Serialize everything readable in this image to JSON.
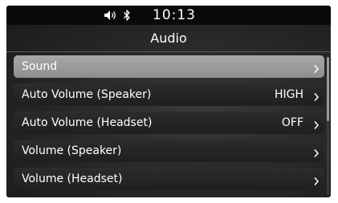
{
  "status_bar": {
    "speaker_icon": "speaker-sound-icon",
    "bluetooth_icon": "bluetooth-icon",
    "time": "10:13"
  },
  "header": {
    "title": "Audio"
  },
  "menu": {
    "items": [
      {
        "label": "Sound",
        "value": "",
        "selected": true
      },
      {
        "label": "Auto Volume (Speaker)",
        "value": "HIGH",
        "selected": false
      },
      {
        "label": "Auto Volume (Headset)",
        "value": "OFF",
        "selected": false
      },
      {
        "label": "Volume (Speaker)",
        "value": "",
        "selected": false
      },
      {
        "label": "Volume (Headset)",
        "value": "",
        "selected": false
      }
    ]
  },
  "colors": {
    "selected_row": "#9c9c9c",
    "row_background": "#262626",
    "status_bar": "#0a0a0a",
    "text": "#ffffff"
  }
}
